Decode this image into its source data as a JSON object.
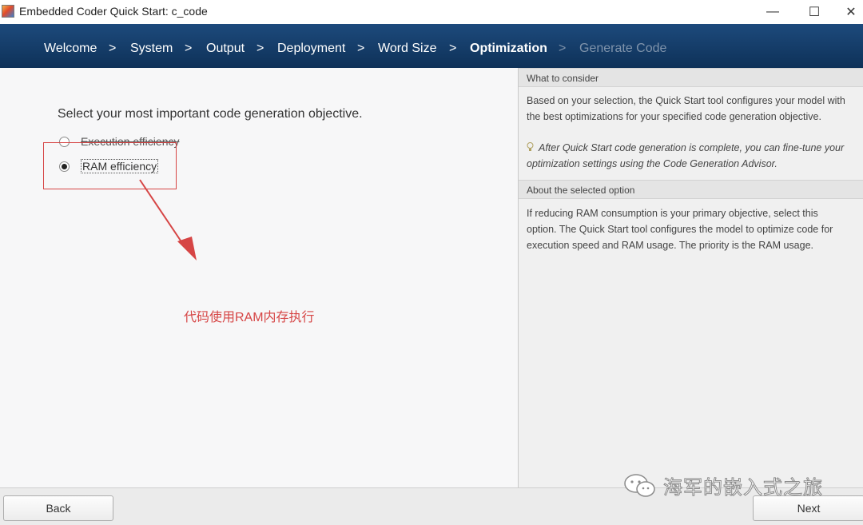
{
  "window": {
    "title": "Embedded Coder Quick Start: c_code",
    "minimize_glyph": "—",
    "maximize_glyph": "☐",
    "close_glyph": "✕"
  },
  "breadcrumbs": {
    "separator": ">",
    "items": [
      {
        "label": "Welcome",
        "state": "done"
      },
      {
        "label": "System",
        "state": "done"
      },
      {
        "label": "Output",
        "state": "done"
      },
      {
        "label": "Deployment",
        "state": "done"
      },
      {
        "label": "Word Size",
        "state": "done"
      },
      {
        "label": "Optimization",
        "state": "current"
      },
      {
        "label": "Generate Code",
        "state": "pending"
      }
    ]
  },
  "main": {
    "prompt": "Select your most important code generation objective.",
    "options": [
      {
        "label": "Execution efficiency",
        "selected": false
      },
      {
        "label": "RAM efficiency",
        "selected": true
      }
    ],
    "annotation": "代码使用RAM内存执行",
    "annotation_color": "#d64545"
  },
  "side_panel": {
    "consider_header": "What to consider",
    "consider_text_1": "Based on your selection, the Quick Start tool configures your model with",
    "consider_text_2": "the best optimizations for your specified code generation objective.",
    "tip_text_1": "After Quick Start code generation is complete, you can fine-tune your",
    "tip_text_2": "optimization settings using the Code Generation Advisor.",
    "tip_icon": "lightbulb-icon",
    "about_header": "About the selected option",
    "about_text_1": "If reducing RAM consumption is your primary objective, select this",
    "about_text_2": "option. The Quick Start tool configures the model to optimize code for",
    "about_text_3": "execution speed and RAM usage. The priority is the RAM usage."
  },
  "footer": {
    "back_label": "Back",
    "next_label": "Next"
  },
  "watermark": {
    "text": "海军的嵌入式之旅",
    "icon": "wechat-icon"
  },
  "colors": {
    "header_bg": "#1d4a7c",
    "accent_red": "#d64545"
  }
}
